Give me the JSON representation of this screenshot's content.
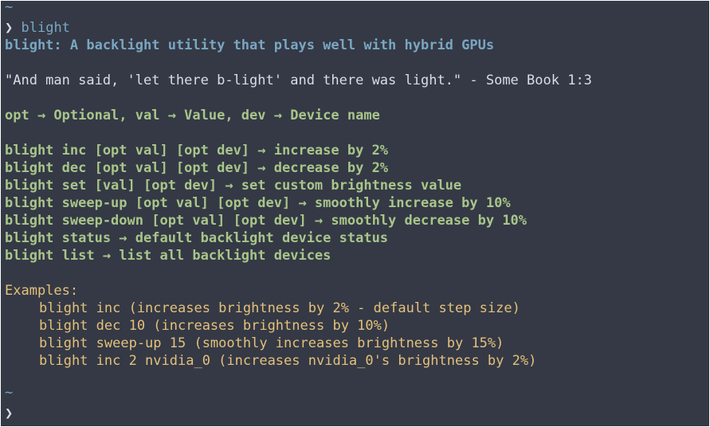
{
  "prompt": {
    "tilde": "~",
    "arrow": "❯",
    "command": "blight",
    "final_tilde": "~",
    "final_arrow": "❯"
  },
  "output": {
    "title": "blight: A backlight utility that plays well with hybrid GPUs",
    "quote": "\"And man said, 'let there b-light' and there was light.\" - Some Book 1:3",
    "legend": "opt → Optional, val → Value, dev → Device name",
    "usage": [
      "blight inc [opt val] [opt dev] → increase by 2%",
      "blight dec [opt val] [opt dev] → decrease by 2%",
      "blight set [val] [opt dev] → set custom brightness value",
      "blight sweep-up [opt val] [opt dev] → smoothly increase by 10%",
      "blight sweep-down [opt val] [opt dev] → smoothly decrease by 10%",
      "blight status → default backlight device status",
      "blight list → list all backlight devices"
    ],
    "examples_label": "Examples:",
    "examples": [
      "blight inc (increases brightness by 2% - default step size)",
      "blight dec 10 (increases brightness by 10%)",
      "blight sweep-up 15 (smoothly increases brightness by 15%)",
      "blight inc 2 nvidia_0 (increases nvidia_0's brightness by 2%)"
    ]
  },
  "colors": {
    "background": "#343945",
    "prompt_blue": "#7aa6c2",
    "text_light": "#d9dde6",
    "usage_green": "#a9c58a",
    "examples_yellow": "#e5c07b"
  }
}
